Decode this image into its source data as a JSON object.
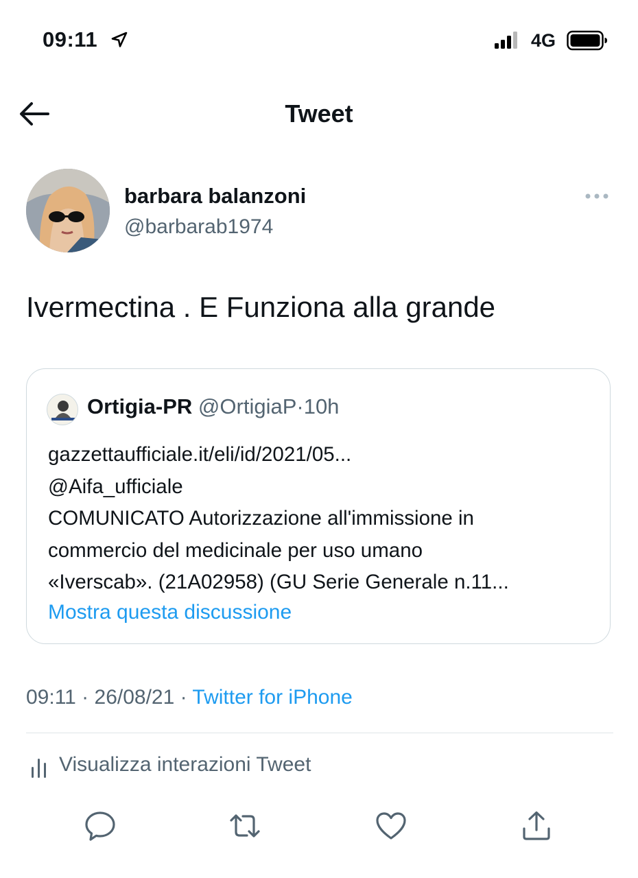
{
  "status_bar": {
    "time": "09:11",
    "network": "4G",
    "icons": [
      "location-arrow-icon",
      "signal-bars-icon",
      "battery-icon"
    ]
  },
  "nav": {
    "title": "Tweet",
    "back_icon": "arrow-left-icon"
  },
  "tweet": {
    "author": {
      "display_name": "barbara balanzoni",
      "handle": "@barbarab1974"
    },
    "more_icon": "more-dots-icon",
    "text": "Ivermectina . E Funziona alla grande",
    "quote": {
      "author_name": "Ortigia-PR",
      "author_handle": "@OrtigiaP",
      "separator": "·",
      "time_ago": "10h",
      "body_lines": [
        "gazzettaufficiale.it/eli/id/2021/05...",
        "@Aifa_ufficiale",
        "COMUNICATO  Autorizzazione all'immissione in",
        "commercio del medicinale per uso umano",
        "«Iverscab». (21A02958) (GU Serie Generale n.11..."
      ],
      "show_thread": "Mostra questa discussione"
    },
    "timestamp": "09:11 · 26/08/21 ·",
    "source": "Twitter for iPhone",
    "analytics_label": "Visualizza interazioni Tweet",
    "actions": [
      "reply-icon",
      "retweet-icon",
      "like-icon",
      "share-icon"
    ]
  },
  "colors": {
    "accent": "#1d9bf0",
    "text": "#0f1419",
    "muted": "#536471",
    "border": "#cfd9de"
  }
}
